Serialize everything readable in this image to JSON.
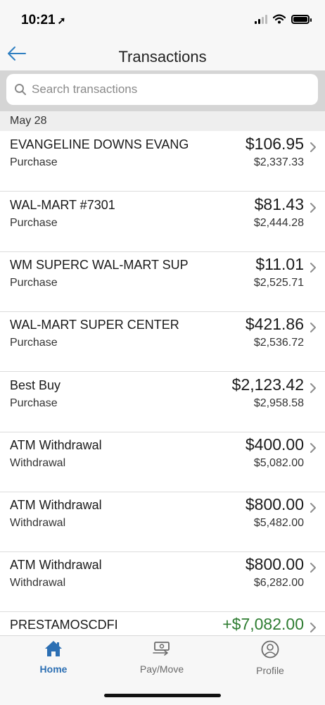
{
  "status_bar": {
    "time": "10:21"
  },
  "header": {
    "title": "Transactions"
  },
  "search": {
    "placeholder": "Search transactions"
  },
  "section": {
    "date": "May 28"
  },
  "transactions": [
    {
      "name": "EVANGELINE DOWNS EVANG",
      "type": "Purchase",
      "amount": "$106.95",
      "balance": "$2,337.33"
    },
    {
      "name": "WAL-MART #7301",
      "type": "Purchase",
      "amount": "$81.43",
      "balance": "$2,444.28"
    },
    {
      "name": "WM SUPERC WAL-MART SUP",
      "type": "Purchase",
      "amount": "$11.01",
      "balance": "$2,525.71"
    },
    {
      "name": "WAL-MART SUPER CENTER",
      "type": "Purchase",
      "amount": "$421.86",
      "balance": "$2,536.72"
    },
    {
      "name": "Best Buy",
      "type": "Purchase",
      "amount": "$2,123.42",
      "balance": "$2,958.58"
    },
    {
      "name": "ATM Withdrawal",
      "type": "Withdrawal",
      "amount": "$400.00",
      "balance": "$5,082.00"
    },
    {
      "name": "ATM Withdrawal",
      "type": "Withdrawal",
      "amount": "$800.00",
      "balance": "$5,482.00"
    },
    {
      "name": "ATM Withdrawal",
      "type": "Withdrawal",
      "amount": "$800.00",
      "balance": "$6,282.00"
    },
    {
      "name": "PRESTAMOSCDFI",
      "type": "",
      "amount": "+$7,082.00",
      "balance": ""
    }
  ],
  "tabs": {
    "home": "Home",
    "pay_move": "Pay/Move",
    "profile": "Profile"
  },
  "colors": {
    "accent": "#2c6fb3",
    "credit": "#2f7d32",
    "back_arrow": "#2f7fc1"
  },
  "icons": {
    "back": "arrow-left-icon",
    "search": "search-icon",
    "home": "home-icon",
    "pay": "money-transfer-icon",
    "profile": "person-circle-icon"
  }
}
